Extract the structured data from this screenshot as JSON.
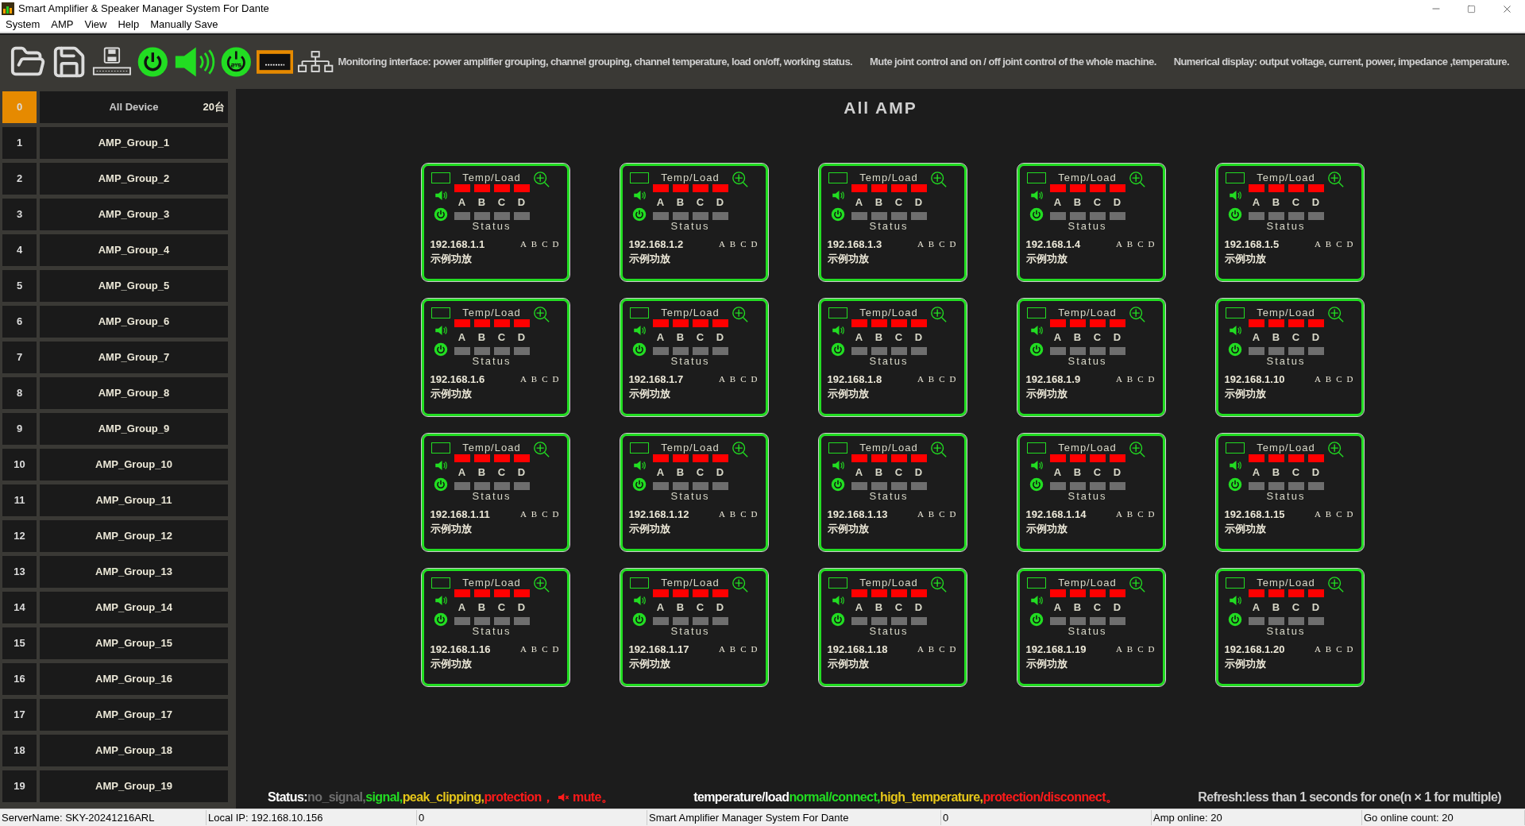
{
  "window": {
    "title": "Smart Amplifier & Speaker Manager System For Dante"
  },
  "menu": [
    "System",
    "AMP",
    "View",
    "Help",
    "Manually Save"
  ],
  "toolbar": {
    "banner": [
      "Monitoring interface: power amplifier grouping, channel grouping, channel temperature, load on/off, working status.",
      "Mute joint control and on / off joint control of the whole machine.",
      "Numerical display: output voltage, current, power, impedance ,temperature."
    ]
  },
  "sidebar": {
    "items": [
      {
        "index": "0",
        "label": "All Device",
        "count": "20台",
        "selected": true
      },
      {
        "index": "1",
        "label": "AMP_Group_1",
        "selected": false
      },
      {
        "index": "2",
        "label": "AMP_Group_2",
        "selected": false
      },
      {
        "index": "3",
        "label": "AMP_Group_3",
        "selected": false
      },
      {
        "index": "4",
        "label": "AMP_Group_4",
        "selected": false
      },
      {
        "index": "5",
        "label": "AMP_Group_5",
        "selected": false
      },
      {
        "index": "6",
        "label": "AMP_Group_6",
        "selected": false
      },
      {
        "index": "7",
        "label": "AMP_Group_7",
        "selected": false
      },
      {
        "index": "8",
        "label": "AMP_Group_8",
        "selected": false
      },
      {
        "index": "9",
        "label": "AMP_Group_9",
        "selected": false
      },
      {
        "index": "10",
        "label": "AMP_Group_10",
        "selected": false
      },
      {
        "index": "11",
        "label": "AMP_Group_11",
        "selected": false
      },
      {
        "index": "12",
        "label": "AMP_Group_12",
        "selected": false
      },
      {
        "index": "13",
        "label": "AMP_Group_13",
        "selected": false
      },
      {
        "index": "14",
        "label": "AMP_Group_14",
        "selected": false
      },
      {
        "index": "15",
        "label": "AMP_Group_15",
        "selected": false
      },
      {
        "index": "16",
        "label": "AMP_Group_16",
        "selected": false
      },
      {
        "index": "17",
        "label": "AMP_Group_17",
        "selected": false
      },
      {
        "index": "18",
        "label": "AMP_Group_18",
        "selected": false
      },
      {
        "index": "19",
        "label": "AMP_Group_19",
        "selected": false
      }
    ]
  },
  "main": {
    "title": "All AMP",
    "cards": [
      {
        "ip": "192.168.1.1",
        "name": "示例功放",
        "temp_label": "Temp/Load",
        "status_label": "Status",
        "temp_indicators": [
          {
            "color": "#ff0000"
          },
          {
            "color": "#ff0000"
          },
          {
            "color": "#ff0000"
          },
          {
            "color": "#ff0000"
          }
        ],
        "channel_letters": [
          "A",
          "B",
          "C",
          "D"
        ],
        "status_indicators": [
          {
            "color": "#6e6e6e"
          },
          {
            "color": "#6e6e6e"
          },
          {
            "color": "#6e6e6e"
          },
          {
            "color": "#6e6e6e"
          }
        ],
        "channel_tags": [
          "A",
          "B",
          "C",
          "D"
        ]
      },
      {
        "ip": "192.168.1.2",
        "name": "示例功放",
        "temp_label": "Temp/Load",
        "status_label": "Status",
        "temp_indicators": [
          {
            "color": "#ff0000"
          },
          {
            "color": "#ff0000"
          },
          {
            "color": "#ff0000"
          },
          {
            "color": "#ff0000"
          }
        ],
        "channel_letters": [
          "A",
          "B",
          "C",
          "D"
        ],
        "status_indicators": [
          {
            "color": "#6e6e6e"
          },
          {
            "color": "#6e6e6e"
          },
          {
            "color": "#6e6e6e"
          },
          {
            "color": "#6e6e6e"
          }
        ],
        "channel_tags": [
          "A",
          "B",
          "C",
          "D"
        ]
      },
      {
        "ip": "192.168.1.3",
        "name": "示例功放",
        "temp_label": "Temp/Load",
        "status_label": "Status",
        "temp_indicators": [
          {
            "color": "#ff0000"
          },
          {
            "color": "#ff0000"
          },
          {
            "color": "#ff0000"
          },
          {
            "color": "#ff0000"
          }
        ],
        "channel_letters": [
          "A",
          "B",
          "C",
          "D"
        ],
        "status_indicators": [
          {
            "color": "#6e6e6e"
          },
          {
            "color": "#6e6e6e"
          },
          {
            "color": "#6e6e6e"
          },
          {
            "color": "#6e6e6e"
          }
        ],
        "channel_tags": [
          "A",
          "B",
          "C",
          "D"
        ]
      },
      {
        "ip": "192.168.1.4",
        "name": "示例功放",
        "temp_label": "Temp/Load",
        "status_label": "Status",
        "temp_indicators": [
          {
            "color": "#ff0000"
          },
          {
            "color": "#ff0000"
          },
          {
            "color": "#ff0000"
          },
          {
            "color": "#ff0000"
          }
        ],
        "channel_letters": [
          "A",
          "B",
          "C",
          "D"
        ],
        "status_indicators": [
          {
            "color": "#6e6e6e"
          },
          {
            "color": "#6e6e6e"
          },
          {
            "color": "#6e6e6e"
          },
          {
            "color": "#6e6e6e"
          }
        ],
        "channel_tags": [
          "A",
          "B",
          "C",
          "D"
        ]
      },
      {
        "ip": "192.168.1.5",
        "name": "示例功放",
        "temp_label": "Temp/Load",
        "status_label": "Status",
        "temp_indicators": [
          {
            "color": "#ff0000"
          },
          {
            "color": "#ff0000"
          },
          {
            "color": "#ff0000"
          },
          {
            "color": "#ff0000"
          }
        ],
        "channel_letters": [
          "A",
          "B",
          "C",
          "D"
        ],
        "status_indicators": [
          {
            "color": "#6e6e6e"
          },
          {
            "color": "#6e6e6e"
          },
          {
            "color": "#6e6e6e"
          },
          {
            "color": "#6e6e6e"
          }
        ],
        "channel_tags": [
          "A",
          "B",
          "C",
          "D"
        ]
      },
      {
        "ip": "192.168.1.6",
        "name": "示例功放",
        "temp_label": "Temp/Load",
        "status_label": "Status",
        "temp_indicators": [
          {
            "color": "#ff0000"
          },
          {
            "color": "#ff0000"
          },
          {
            "color": "#ff0000"
          },
          {
            "color": "#ff0000"
          }
        ],
        "channel_letters": [
          "A",
          "B",
          "C",
          "D"
        ],
        "status_indicators": [
          {
            "color": "#6e6e6e"
          },
          {
            "color": "#6e6e6e"
          },
          {
            "color": "#6e6e6e"
          },
          {
            "color": "#6e6e6e"
          }
        ],
        "channel_tags": [
          "A",
          "B",
          "C",
          "D"
        ]
      },
      {
        "ip": "192.168.1.7",
        "name": "示例功放",
        "temp_label": "Temp/Load",
        "status_label": "Status",
        "temp_indicators": [
          {
            "color": "#ff0000"
          },
          {
            "color": "#ff0000"
          },
          {
            "color": "#ff0000"
          },
          {
            "color": "#ff0000"
          }
        ],
        "channel_letters": [
          "A",
          "B",
          "C",
          "D"
        ],
        "status_indicators": [
          {
            "color": "#6e6e6e"
          },
          {
            "color": "#6e6e6e"
          },
          {
            "color": "#6e6e6e"
          },
          {
            "color": "#6e6e6e"
          }
        ],
        "channel_tags": [
          "A",
          "B",
          "C",
          "D"
        ]
      },
      {
        "ip": "192.168.1.8",
        "name": "示例功放",
        "temp_label": "Temp/Load",
        "status_label": "Status",
        "temp_indicators": [
          {
            "color": "#ff0000"
          },
          {
            "color": "#ff0000"
          },
          {
            "color": "#ff0000"
          },
          {
            "color": "#ff0000"
          }
        ],
        "channel_letters": [
          "A",
          "B",
          "C",
          "D"
        ],
        "status_indicators": [
          {
            "color": "#6e6e6e"
          },
          {
            "color": "#6e6e6e"
          },
          {
            "color": "#6e6e6e"
          },
          {
            "color": "#6e6e6e"
          }
        ],
        "channel_tags": [
          "A",
          "B",
          "C",
          "D"
        ]
      },
      {
        "ip": "192.168.1.9",
        "name": "示例功放",
        "temp_label": "Temp/Load",
        "status_label": "Status",
        "temp_indicators": [
          {
            "color": "#ff0000"
          },
          {
            "color": "#ff0000"
          },
          {
            "color": "#ff0000"
          },
          {
            "color": "#ff0000"
          }
        ],
        "channel_letters": [
          "A",
          "B",
          "C",
          "D"
        ],
        "status_indicators": [
          {
            "color": "#6e6e6e"
          },
          {
            "color": "#6e6e6e"
          },
          {
            "color": "#6e6e6e"
          },
          {
            "color": "#6e6e6e"
          }
        ],
        "channel_tags": [
          "A",
          "B",
          "C",
          "D"
        ]
      },
      {
        "ip": "192.168.1.10",
        "name": "示例功放",
        "temp_label": "Temp/Load",
        "status_label": "Status",
        "temp_indicators": [
          {
            "color": "#ff0000"
          },
          {
            "color": "#ff0000"
          },
          {
            "color": "#ff0000"
          },
          {
            "color": "#ff0000"
          }
        ],
        "channel_letters": [
          "A",
          "B",
          "C",
          "D"
        ],
        "status_indicators": [
          {
            "color": "#6e6e6e"
          },
          {
            "color": "#6e6e6e"
          },
          {
            "color": "#6e6e6e"
          },
          {
            "color": "#6e6e6e"
          }
        ],
        "channel_tags": [
          "A",
          "B",
          "C",
          "D"
        ]
      },
      {
        "ip": "192.168.1.11",
        "name": "示例功放",
        "temp_label": "Temp/Load",
        "status_label": "Status",
        "temp_indicators": [
          {
            "color": "#ff0000"
          },
          {
            "color": "#ff0000"
          },
          {
            "color": "#ff0000"
          },
          {
            "color": "#ff0000"
          }
        ],
        "channel_letters": [
          "A",
          "B",
          "C",
          "D"
        ],
        "status_indicators": [
          {
            "color": "#6e6e6e"
          },
          {
            "color": "#6e6e6e"
          },
          {
            "color": "#6e6e6e"
          },
          {
            "color": "#6e6e6e"
          }
        ],
        "channel_tags": [
          "A",
          "B",
          "C",
          "D"
        ]
      },
      {
        "ip": "192.168.1.12",
        "name": "示例功放",
        "temp_label": "Temp/Load",
        "status_label": "Status",
        "temp_indicators": [
          {
            "color": "#ff0000"
          },
          {
            "color": "#ff0000"
          },
          {
            "color": "#ff0000"
          },
          {
            "color": "#ff0000"
          }
        ],
        "channel_letters": [
          "A",
          "B",
          "C",
          "D"
        ],
        "status_indicators": [
          {
            "color": "#6e6e6e"
          },
          {
            "color": "#6e6e6e"
          },
          {
            "color": "#6e6e6e"
          },
          {
            "color": "#6e6e6e"
          }
        ],
        "channel_tags": [
          "A",
          "B",
          "C",
          "D"
        ]
      },
      {
        "ip": "192.168.1.13",
        "name": "示例功放",
        "temp_label": "Temp/Load",
        "status_label": "Status",
        "temp_indicators": [
          {
            "color": "#ff0000"
          },
          {
            "color": "#ff0000"
          },
          {
            "color": "#ff0000"
          },
          {
            "color": "#ff0000"
          }
        ],
        "channel_letters": [
          "A",
          "B",
          "C",
          "D"
        ],
        "status_indicators": [
          {
            "color": "#6e6e6e"
          },
          {
            "color": "#6e6e6e"
          },
          {
            "color": "#6e6e6e"
          },
          {
            "color": "#6e6e6e"
          }
        ],
        "channel_tags": [
          "A",
          "B",
          "C",
          "D"
        ]
      },
      {
        "ip": "192.168.1.14",
        "name": "示例功放",
        "temp_label": "Temp/Load",
        "status_label": "Status",
        "temp_indicators": [
          {
            "color": "#ff0000"
          },
          {
            "color": "#ff0000"
          },
          {
            "color": "#ff0000"
          },
          {
            "color": "#ff0000"
          }
        ],
        "channel_letters": [
          "A",
          "B",
          "C",
          "D"
        ],
        "status_indicators": [
          {
            "color": "#6e6e6e"
          },
          {
            "color": "#6e6e6e"
          },
          {
            "color": "#6e6e6e"
          },
          {
            "color": "#6e6e6e"
          }
        ],
        "channel_tags": [
          "A",
          "B",
          "C",
          "D"
        ]
      },
      {
        "ip": "192.168.1.15",
        "name": "示例功放",
        "temp_label": "Temp/Load",
        "status_label": "Status",
        "temp_indicators": [
          {
            "color": "#ff0000"
          },
          {
            "color": "#ff0000"
          },
          {
            "color": "#ff0000"
          },
          {
            "color": "#ff0000"
          }
        ],
        "channel_letters": [
          "A",
          "B",
          "C",
          "D"
        ],
        "status_indicators": [
          {
            "color": "#6e6e6e"
          },
          {
            "color": "#6e6e6e"
          },
          {
            "color": "#6e6e6e"
          },
          {
            "color": "#6e6e6e"
          }
        ],
        "channel_tags": [
          "A",
          "B",
          "C",
          "D"
        ]
      },
      {
        "ip": "192.168.1.16",
        "name": "示例功放",
        "temp_label": "Temp/Load",
        "status_label": "Status",
        "temp_indicators": [
          {
            "color": "#ff0000"
          },
          {
            "color": "#ff0000"
          },
          {
            "color": "#ff0000"
          },
          {
            "color": "#ff0000"
          }
        ],
        "channel_letters": [
          "A",
          "B",
          "C",
          "D"
        ],
        "status_indicators": [
          {
            "color": "#6e6e6e"
          },
          {
            "color": "#6e6e6e"
          },
          {
            "color": "#6e6e6e"
          },
          {
            "color": "#6e6e6e"
          }
        ],
        "channel_tags": [
          "A",
          "B",
          "C",
          "D"
        ]
      },
      {
        "ip": "192.168.1.17",
        "name": "示例功放",
        "temp_label": "Temp/Load",
        "status_label": "Status",
        "temp_indicators": [
          {
            "color": "#ff0000"
          },
          {
            "color": "#ff0000"
          },
          {
            "color": "#ff0000"
          },
          {
            "color": "#ff0000"
          }
        ],
        "channel_letters": [
          "A",
          "B",
          "C",
          "D"
        ],
        "status_indicators": [
          {
            "color": "#6e6e6e"
          },
          {
            "color": "#6e6e6e"
          },
          {
            "color": "#6e6e6e"
          },
          {
            "color": "#6e6e6e"
          }
        ],
        "channel_tags": [
          "A",
          "B",
          "C",
          "D"
        ]
      },
      {
        "ip": "192.168.1.18",
        "name": "示例功放",
        "temp_label": "Temp/Load",
        "status_label": "Status",
        "temp_indicators": [
          {
            "color": "#ff0000"
          },
          {
            "color": "#ff0000"
          },
          {
            "color": "#ff0000"
          },
          {
            "color": "#ff0000"
          }
        ],
        "channel_letters": [
          "A",
          "B",
          "C",
          "D"
        ],
        "status_indicators": [
          {
            "color": "#6e6e6e"
          },
          {
            "color": "#6e6e6e"
          },
          {
            "color": "#6e6e6e"
          },
          {
            "color": "#6e6e6e"
          }
        ],
        "channel_tags": [
          "A",
          "B",
          "C",
          "D"
        ]
      },
      {
        "ip": "192.168.1.19",
        "name": "示例功放",
        "temp_label": "Temp/Load",
        "status_label": "Status",
        "temp_indicators": [
          {
            "color": "#ff0000"
          },
          {
            "color": "#ff0000"
          },
          {
            "color": "#ff0000"
          },
          {
            "color": "#ff0000"
          }
        ],
        "channel_letters": [
          "A",
          "B",
          "C",
          "D"
        ],
        "status_indicators": [
          {
            "color": "#6e6e6e"
          },
          {
            "color": "#6e6e6e"
          },
          {
            "color": "#6e6e6e"
          },
          {
            "color": "#6e6e6e"
          }
        ],
        "channel_tags": [
          "A",
          "B",
          "C",
          "D"
        ]
      },
      {
        "ip": "192.168.1.20",
        "name": "示例功放",
        "temp_label": "Temp/Load",
        "status_label": "Status",
        "temp_indicators": [
          {
            "color": "#ff0000"
          },
          {
            "color": "#ff0000"
          },
          {
            "color": "#ff0000"
          },
          {
            "color": "#ff0000"
          }
        ],
        "channel_letters": [
          "A",
          "B",
          "C",
          "D"
        ],
        "status_indicators": [
          {
            "color": "#6e6e6e"
          },
          {
            "color": "#6e6e6e"
          },
          {
            "color": "#6e6e6e"
          },
          {
            "color": "#6e6e6e"
          }
        ],
        "channel_tags": [
          "A",
          "B",
          "C",
          "D"
        ]
      }
    ],
    "legend": [
      [
        {
          "kind": "text",
          "text": "Status:",
          "color": "#ffffff"
        },
        {
          "kind": "text",
          "text": "no_signal,",
          "color": "#6e6e6e"
        },
        {
          "kind": "text",
          "text": "signal,",
          "color": "#22dd22"
        },
        {
          "kind": "text",
          "text": "peak_clipping,",
          "color": "#e6c619"
        },
        {
          "kind": "text",
          "text": "protection，",
          "color": "#ff1a1a"
        },
        {
          "kind": "mute-icon",
          "color": "#ff1a1a"
        },
        {
          "kind": "text",
          "text": "mute。",
          "color": "#ff1a1a"
        }
      ],
      [
        {
          "kind": "text",
          "text": "temperature/load",
          "color": "#ffffff"
        },
        {
          "kind": "text",
          "text": "normal/connect,",
          "color": "#22dd22"
        },
        {
          "kind": "text",
          "text": "high_temperature,",
          "color": "#e6c619"
        },
        {
          "kind": "text",
          "text": "protection/disconnect。",
          "color": "#ff1a1a"
        }
      ],
      [
        {
          "kind": "text",
          "text": "Refresh:less than 1 seconds for one(n × 1 for multiple)",
          "color": "#d0d0d0"
        }
      ]
    ]
  },
  "status_bar": [
    "ServerName:  SKY-20241216ARL",
    "Local IP:  192.168.10.156",
    "0",
    "Smart Amplifier Manager System For Dante",
    "0",
    "Amp online:  20",
    "Go online count:  20"
  ]
}
